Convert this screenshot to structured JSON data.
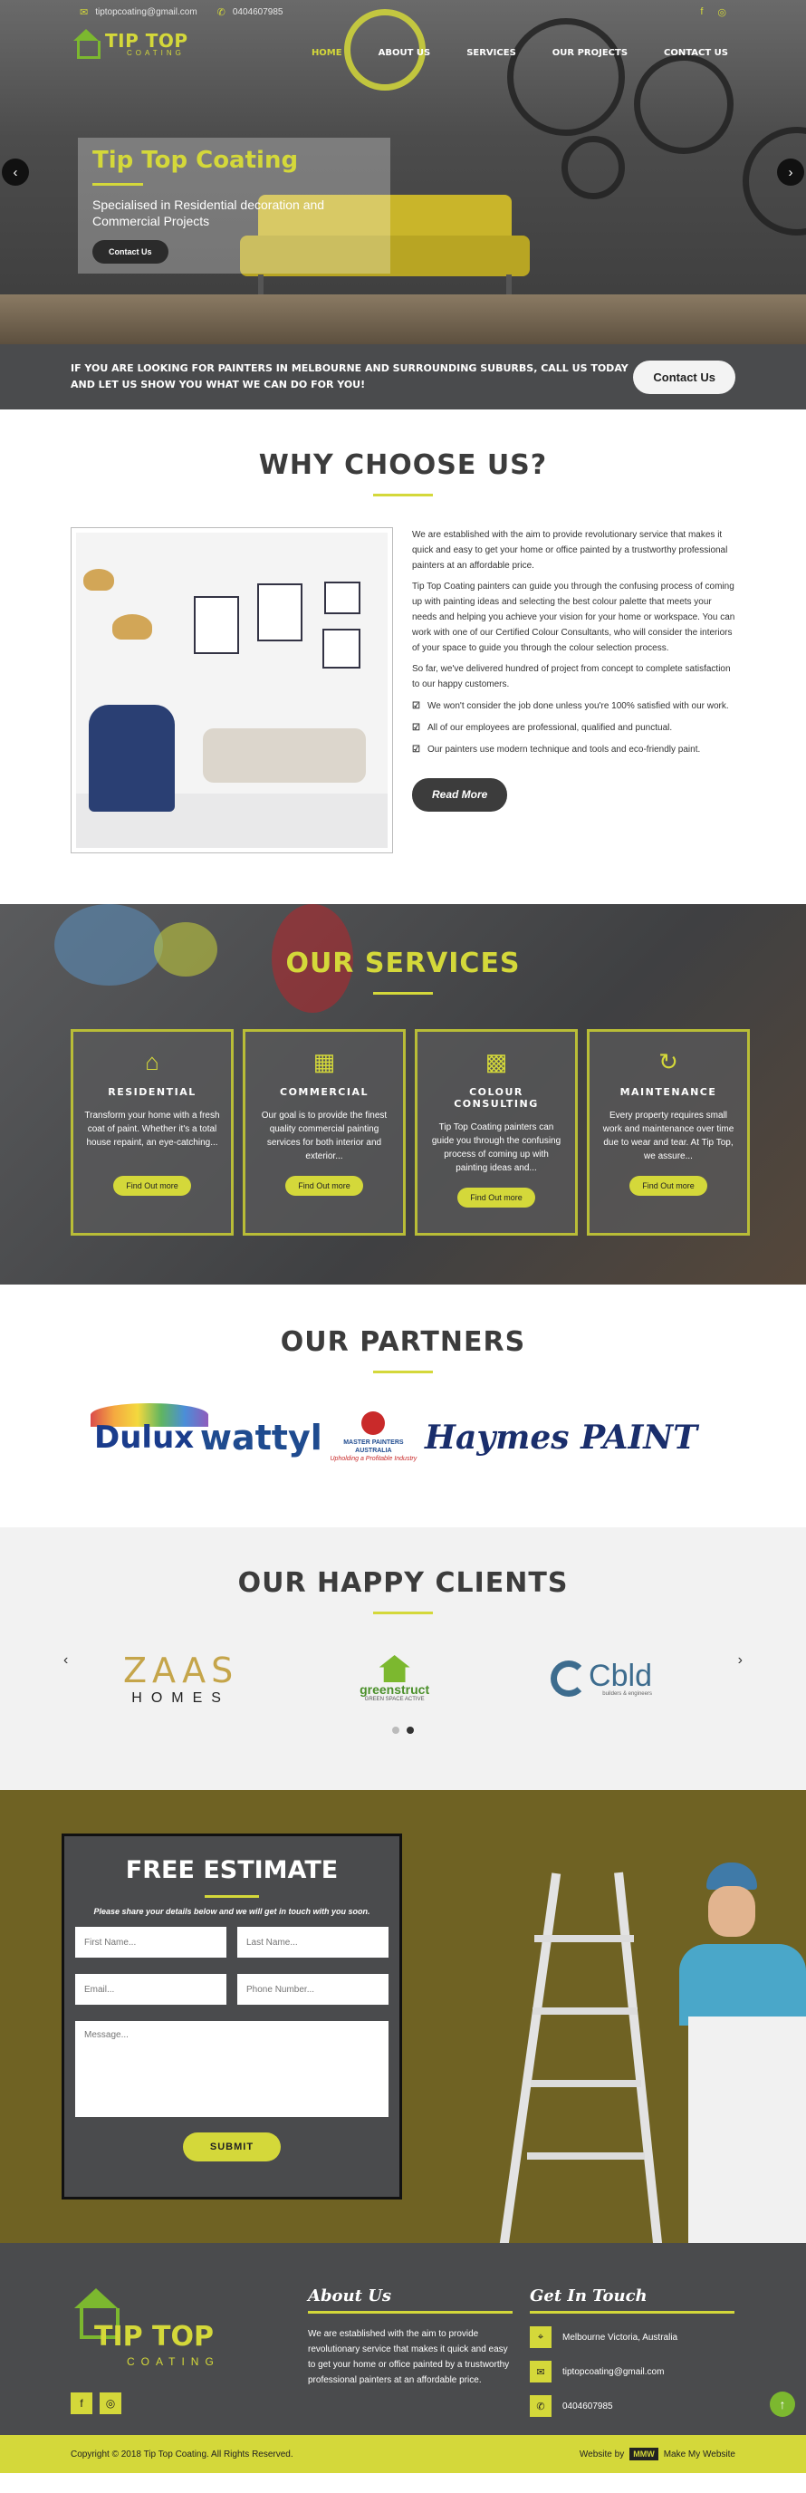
{
  "topbar": {
    "email": "tiptopcoating@gmail.com",
    "phone": "0404607985",
    "email_icon": "envelope-icon",
    "phone_icon": "phone-icon"
  },
  "logo": {
    "line1": "TIP TOP",
    "line2": "COATING"
  },
  "nav": {
    "items": [
      {
        "label": "HOME",
        "active": true
      },
      {
        "label": "ABOUT US",
        "active": false
      },
      {
        "label": "SERVICES",
        "active": false
      },
      {
        "label": "OUR PROJECTS",
        "active": false
      },
      {
        "label": "CONTACT US",
        "active": false
      }
    ]
  },
  "hero": {
    "title": "Tip Top Coating",
    "subtitle": "Specialised in Residential decoration and Commercial Projects",
    "button": "Contact Us",
    "prev_arrow": "‹",
    "next_arrow": "›"
  },
  "cta": {
    "text": "IF YOU ARE LOOKING FOR PAINTERS IN MELBOURNE AND SURROUNDING SUBURBS, CALL US TODAY AND LET US SHOW YOU WHAT WE CAN DO FOR YOU!",
    "button": "Contact Us"
  },
  "why": {
    "title": "WHY CHOOSE US?",
    "p1": "We are established with the aim to provide revolutionary service that makes it quick and easy to get your home or office painted by a trustworthy professional painters at an affordable price.",
    "p2": "Tip Top Coating painters can guide you through the confusing process of coming up with painting ideas and selecting the best colour palette that meets your needs and helping you achieve your vision for your home or workspace. You can work with one of our Certified Colour Consultants, who will consider the interiors of your space to guide you through the colour selection process.",
    "p3": "So far, we've delivered hundred of project from concept to complete satisfaction to our happy customers.",
    "bullets": [
      "We won't consider the job done unless you're 100% satisfied with our work.",
      "All of our employees are professional, qualified and punctual.",
      "Our painters use modern technique and tools and eco-friendly paint."
    ],
    "button": "Read More"
  },
  "services": {
    "title": "OUR SERVICES",
    "items": [
      {
        "icon": "home-icon",
        "title": "RESIDENTIAL",
        "text": "Transform your home with a fresh coat of paint. Whether it's a total house repaint, an eye-catching...",
        "button": "Find Out more"
      },
      {
        "icon": "building-icon",
        "title": "COMMERCIAL",
        "text": "Our goal is to provide the finest quality commercial painting services for both interior and exterior...",
        "button": "Find Out more"
      },
      {
        "icon": "qr-code-icon",
        "title": "COLOUR CONSULTING",
        "text": "Tip Top Coating painters can guide you through the confusing process of coming up with painting ideas and...",
        "button": "Find Out more"
      },
      {
        "icon": "refresh-icon",
        "title": "MAINTENANCE",
        "text": "Every property requires small work and maintenance over time due to wear and tear. At Tip Top, we assure...",
        "button": "Find Out more"
      }
    ]
  },
  "partners": {
    "title": "OUR PARTNERS",
    "logos": [
      "Dulux",
      "wattyl",
      "MASTER PAINTERS AUSTRALIA",
      "Haymes PAINT"
    ],
    "mpa_tagline": "Upholding a Profitable Industry"
  },
  "clients": {
    "title": "OUR HAPPY CLIENTS",
    "logos": [
      {
        "main": "ZAAS",
        "sub": "HOMES"
      },
      {
        "main": "greenstruct",
        "sub": "GREEN SPACE ACTIVE"
      },
      {
        "main": "Cbld",
        "sub": "builders & engineers"
      }
    ],
    "prev": "‹",
    "next": "›"
  },
  "estimate": {
    "title": "FREE ESTIMATE",
    "note": "Please share your details below and we will get in touch with you soon.",
    "first_name": "First Name...",
    "last_name": "Last Name...",
    "email": "Email...",
    "phone": "Phone Number...",
    "message": "Message...",
    "submit": "SUBMIT"
  },
  "footer": {
    "about_title": "About Us",
    "about_text": "We are established with the aim to provide revolutionary service that makes it quick and easy to get your home or office painted by a trustworthy professional painters at an affordable price.",
    "contact_title": "Get In Touch",
    "address": "Melbourne Victoria, Australia",
    "email": "tiptopcoating@gmail.com",
    "phone": "0404607985",
    "copyright": "Copyright © 2018 Tip Top Coating. All Rights Reserved.",
    "website_by": "Website by",
    "mmw_badge": "MMW",
    "make_my_website": "Make My Website"
  },
  "colors": {
    "accent": "#d4d83a",
    "dark": "#4a4b4d",
    "green": "#7cb82f",
    "olive": "#6f6223"
  }
}
